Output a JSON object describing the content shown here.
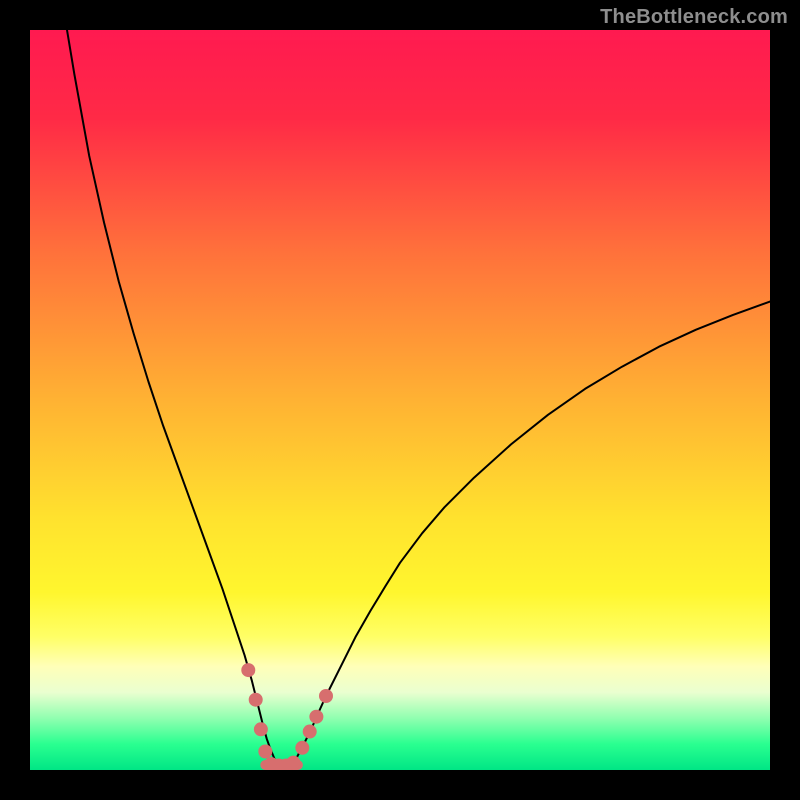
{
  "watermark": {
    "text": "TheBottleneck.com"
  },
  "gradient": {
    "stops": [
      {
        "offset": 0.0,
        "color": "#ff1a50"
      },
      {
        "offset": 0.12,
        "color": "#ff2a46"
      },
      {
        "offset": 0.3,
        "color": "#ff713b"
      },
      {
        "offset": 0.5,
        "color": "#ffb233"
      },
      {
        "offset": 0.66,
        "color": "#ffe22e"
      },
      {
        "offset": 0.76,
        "color": "#fff62e"
      },
      {
        "offset": 0.82,
        "color": "#ffff66"
      },
      {
        "offset": 0.86,
        "color": "#ffffb8"
      },
      {
        "offset": 0.895,
        "color": "#eaffd0"
      },
      {
        "offset": 0.93,
        "color": "#90ffb0"
      },
      {
        "offset": 0.965,
        "color": "#2aff90"
      },
      {
        "offset": 1.0,
        "color": "#00e685"
      }
    ]
  },
  "chart_data": {
    "type": "line",
    "title": "",
    "xlabel": "",
    "ylabel": "",
    "ylim": [
      0,
      100
    ],
    "xlim": [
      0,
      100
    ],
    "x": [
      5,
      6,
      8,
      10,
      12,
      14,
      16,
      18,
      20,
      22,
      24,
      26,
      27,
      28,
      29,
      30,
      30.5,
      31,
      31.5,
      32,
      32.5,
      33,
      33.5,
      34,
      34.5,
      35,
      35.5,
      36,
      37,
      38,
      39,
      40,
      42,
      44,
      46,
      48,
      50,
      53,
      56,
      60,
      65,
      70,
      75,
      80,
      85,
      90,
      95,
      100
    ],
    "values": [
      100,
      94,
      83,
      74,
      66,
      59,
      52.5,
      46.5,
      41,
      35.5,
      30,
      24.5,
      21.5,
      18.5,
      15.5,
      12,
      10,
      8,
      6,
      4.2,
      2.8,
      1.6,
      0.8,
      0.3,
      0.2,
      0.3,
      0.8,
      1.6,
      3.5,
      5.5,
      7.8,
      10,
      14,
      18,
      21.5,
      24.8,
      28,
      32,
      35.5,
      39.5,
      44,
      48,
      51.5,
      54.5,
      57.2,
      59.5,
      61.5,
      63.3
    ],
    "markers": {
      "color": "#d76e6e",
      "radius_px": 7,
      "points_xy": [
        [
          29.5,
          13.5
        ],
        [
          30.5,
          9.5
        ],
        [
          31.2,
          5.5
        ],
        [
          31.8,
          2.5
        ],
        [
          32.6,
          0.8
        ],
        [
          33.6,
          0.6
        ],
        [
          34.6,
          0.6
        ],
        [
          35.6,
          1.0
        ],
        [
          36.8,
          3.0
        ],
        [
          37.8,
          5.2
        ],
        [
          38.7,
          7.2
        ],
        [
          40.0,
          10.0
        ]
      ]
    },
    "bottom_band": {
      "color": "#d76e6e",
      "x_start": 31.8,
      "x_end": 36.2,
      "thickness_px": 10
    }
  }
}
